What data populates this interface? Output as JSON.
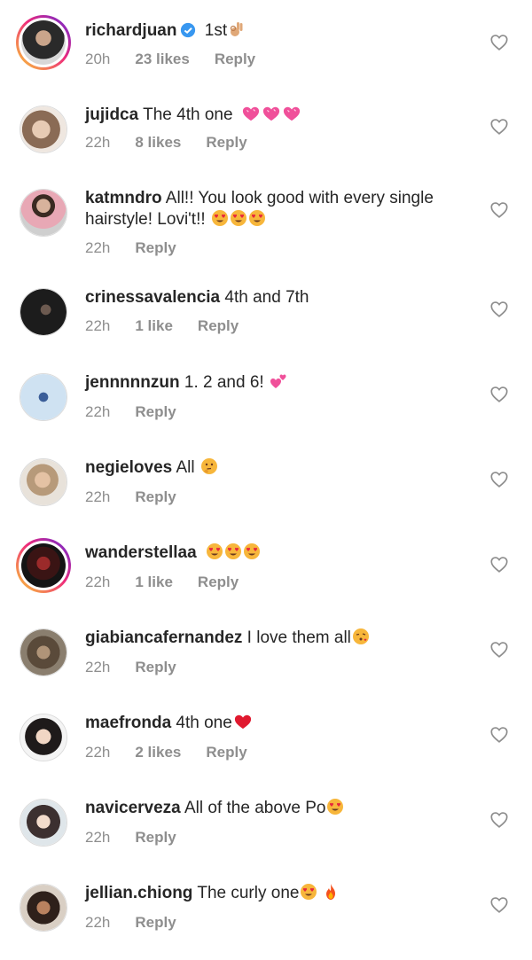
{
  "comments": [
    {
      "username": "richardjuan",
      "text": " 1st",
      "time": "20h",
      "likes": "23 likes",
      "reply": "Reply"
    },
    {
      "username": "jujidca",
      "text": " The 4th one",
      "time": "22h",
      "likes": "8 likes",
      "reply": "Reply"
    },
    {
      "username": "katmndro",
      "text": " All!! You look good with every single hairstyle! Lovi't!!",
      "time": "22h",
      "likes": "",
      "reply": "Reply"
    },
    {
      "username": "crinessavalencia",
      "text": " 4th and 7th",
      "time": "22h",
      "likes": "1 like",
      "reply": "Reply"
    },
    {
      "username": "jennnnnzun",
      "text": " 1. 2 and 6!",
      "time": "22h",
      "likes": "",
      "reply": "Reply"
    },
    {
      "username": "negieloves",
      "text": " All",
      "time": "22h",
      "likes": "",
      "reply": "Reply"
    },
    {
      "username": "wanderstellaa",
      "text": "",
      "time": "22h",
      "likes": "1 like",
      "reply": "Reply"
    },
    {
      "username": "giabiancafernandez",
      "text": " I love them all",
      "time": "22h",
      "likes": "",
      "reply": "Reply"
    },
    {
      "username": "maefronda",
      "text": " 4th one",
      "time": "22h",
      "likes": "2 likes",
      "reply": "Reply"
    },
    {
      "username": "navicerveza",
      "text": " All of the above Po",
      "time": "22h",
      "likes": "",
      "reply": "Reply"
    },
    {
      "username": "jellian.chiong",
      "text": " The curly one",
      "time": "22h",
      "likes": "",
      "reply": "Reply"
    }
  ],
  "icons": {
    "heart": "heart-outline-icon",
    "verified": "verified-badge-icon",
    "emojis": [
      "ok-hand",
      "pink-hearts",
      "heart-eyes",
      "two-hearts",
      "thinking-face",
      "kissing-heart",
      "red-heart",
      "fire"
    ]
  },
  "colors": {
    "meta": "#8e8e8e",
    "text": "#262626",
    "verified": "#3897f0",
    "story_ring": "#ee2a7b"
  }
}
